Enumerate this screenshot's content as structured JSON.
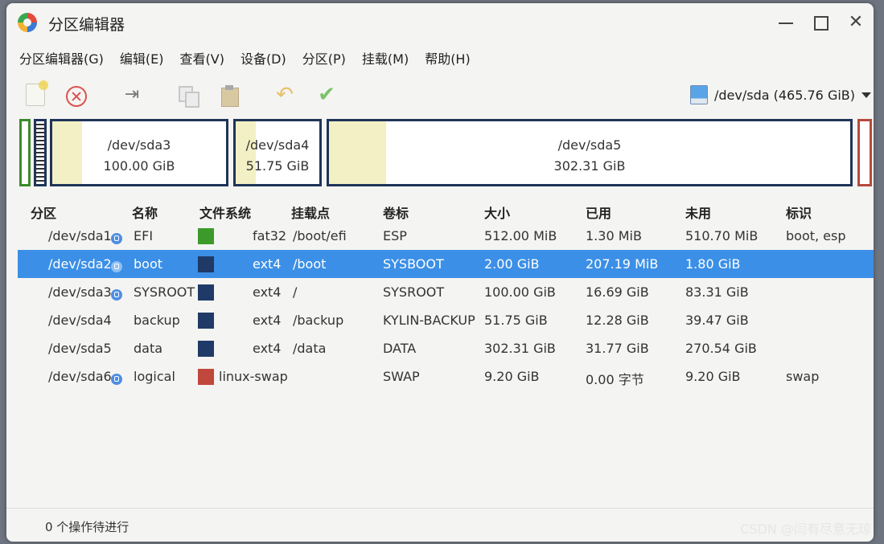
{
  "window": {
    "title": "分区编辑器",
    "minimize_icon": "minimize-icon",
    "maximize_icon": "maximize-icon",
    "close_icon": "close-icon"
  },
  "menu": [
    "分区编辑器(G)",
    "编辑(E)",
    "查看(V)",
    "设备(D)",
    "分区(P)",
    "挂载(M)",
    "帮助(H)"
  ],
  "toolbar": {
    "device": "/dev/sda  (465.76 GiB)"
  },
  "graph": {
    "sda3": {
      "name": "/dev/sda3",
      "size": "100.00 GiB"
    },
    "sda4": {
      "name": "/dev/sda4",
      "size": "51.75 GiB"
    },
    "sda5": {
      "name": "/dev/sda5",
      "size": "302.31 GiB"
    }
  },
  "table": {
    "headers": [
      "分区",
      "名称",
      "文件系统",
      "挂载点",
      "卷标",
      "大小",
      "已用",
      "未用",
      "标识"
    ],
    "rows": [
      {
        "partition": "/dev/sda1",
        "locked": true,
        "name": "EFI",
        "fs_color": "#3c9a2b",
        "fs": "fat32",
        "mount": "/boot/efi",
        "label": "ESP",
        "size": "512.00 MiB",
        "used": "1.30 MiB",
        "unused": "510.70 MiB",
        "flags": "boot, esp"
      },
      {
        "partition": "/dev/sda2",
        "locked": true,
        "name": "boot",
        "fs_color": "#1f3a66",
        "fs": "ext4",
        "mount": "/boot",
        "label": "SYSBOOT",
        "size": "2.00 GiB",
        "used": "207.19 MiB",
        "unused": "1.80 GiB",
        "flags": ""
      },
      {
        "partition": "/dev/sda3",
        "locked": true,
        "name": "SYSROOT",
        "fs_color": "#1f3a66",
        "fs": "ext4",
        "mount": "/",
        "label": "SYSROOT",
        "size": "100.00 GiB",
        "used": "16.69 GiB",
        "unused": "83.31 GiB",
        "flags": ""
      },
      {
        "partition": "/dev/sda4",
        "locked": false,
        "name": "backup",
        "fs_color": "#1f3a66",
        "fs": "ext4",
        "mount": "/backup",
        "label": "KYLIN-BACKUP",
        "size": "51.75 GiB",
        "used": "12.28 GiB",
        "unused": "39.47 GiB",
        "flags": ""
      },
      {
        "partition": "/dev/sda5",
        "locked": false,
        "name": "data",
        "fs_color": "#1f3a66",
        "fs": "ext4",
        "mount": "/data",
        "label": "DATA",
        "size": "302.31 GiB",
        "used": "31.77 GiB",
        "unused": "270.54 GiB",
        "flags": ""
      },
      {
        "partition": "/dev/sda6",
        "locked": true,
        "name": "logical",
        "fs_color": "#c0473b",
        "fs": "linux-swap",
        "mount": "",
        "label": "SWAP",
        "size": "9.20 GiB",
        "used": "0.00 字节",
        "unused": "9.20 GiB",
        "flags": "swap"
      }
    ]
  },
  "status": "0 个操作待进行",
  "watermark": "CSDN @闫有尽意无琼"
}
